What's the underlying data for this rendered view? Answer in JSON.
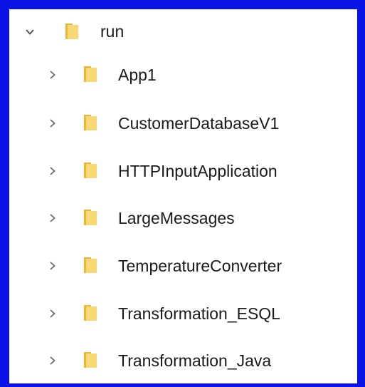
{
  "tree": {
    "root": {
      "label": "run",
      "expanded_icon": "chevron-down-icon",
      "folder_icon": "folder-icon"
    },
    "children": [
      {
        "label": "App1"
      },
      {
        "label": "CustomerDatabaseV1"
      },
      {
        "label": "HTTPInputApplication"
      },
      {
        "label": "LargeMessages"
      },
      {
        "label": "TemperatureConverter"
      },
      {
        "label": "Transformation_ESQL"
      },
      {
        "label": "Transformation_Java"
      }
    ],
    "collapsed_icon": "chevron-right-icon"
  },
  "colors": {
    "border": "#0a14e6",
    "folder_body": "#f8d775",
    "folder_back": "#e8b832",
    "chevron": "#6b6b6b",
    "text": "#1a1a1a"
  }
}
